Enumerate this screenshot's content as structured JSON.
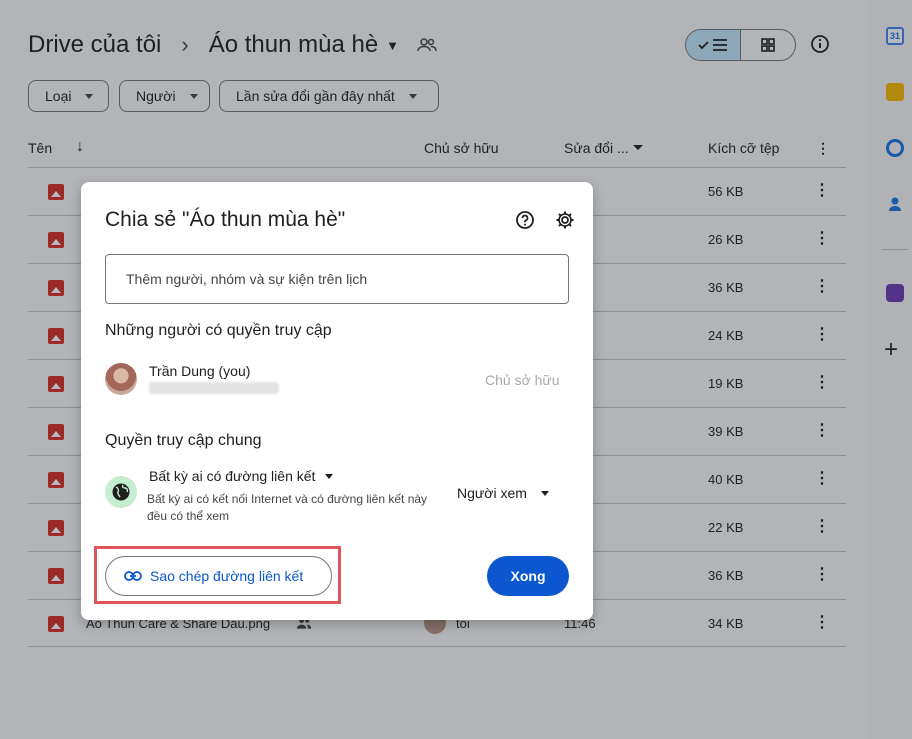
{
  "breadcrumb": {
    "root": "Drive của tôi",
    "separator": "›",
    "folder": "Áo thun mùa hè"
  },
  "filters": [
    "Loại",
    "Người",
    "Lần sửa đổi gần đây nhất"
  ],
  "table": {
    "columns": {
      "name": "Tên",
      "owner": "Chủ sở hữu",
      "modified": "Sửa đổi ...",
      "size": "Kích cỡ tệp"
    },
    "rows": [
      {
        "size": "56 KB"
      },
      {
        "size": "26 KB"
      },
      {
        "size": "36 KB"
      },
      {
        "size": "24 KB"
      },
      {
        "size": "19 KB"
      },
      {
        "size": "39 KB"
      },
      {
        "size": "40 KB"
      },
      {
        "size": "22 KB"
      },
      {
        "size": "36 KB"
      },
      {
        "name": "Áo Thun Care & Share Dau.png",
        "owner": "tôi",
        "modified": "11:46",
        "size": "34 KB"
      }
    ]
  },
  "dialog": {
    "title": "Chia sẻ \"Áo thun mùa hè\"",
    "input_placeholder": "Thêm người, nhóm và sự kiện trên lịch",
    "access_title": "Những người có quyền truy cập",
    "user": {
      "name": "Trần Dung (you)",
      "role": "Chủ sở hữu"
    },
    "general_title": "Quyền truy cập chung",
    "general_option": "Bất kỳ ai có đường liên kết",
    "general_desc": "Bất kỳ ai có kết nối Internet và có đường liên kết này đều có thể xem",
    "role_option": "Người xem",
    "copy_link": "Sao chép đường liên kết",
    "done": "Xong"
  },
  "colors": {
    "primary": "#0b57d0",
    "highlight": "#e0555b",
    "file_icon": "#d93025"
  }
}
